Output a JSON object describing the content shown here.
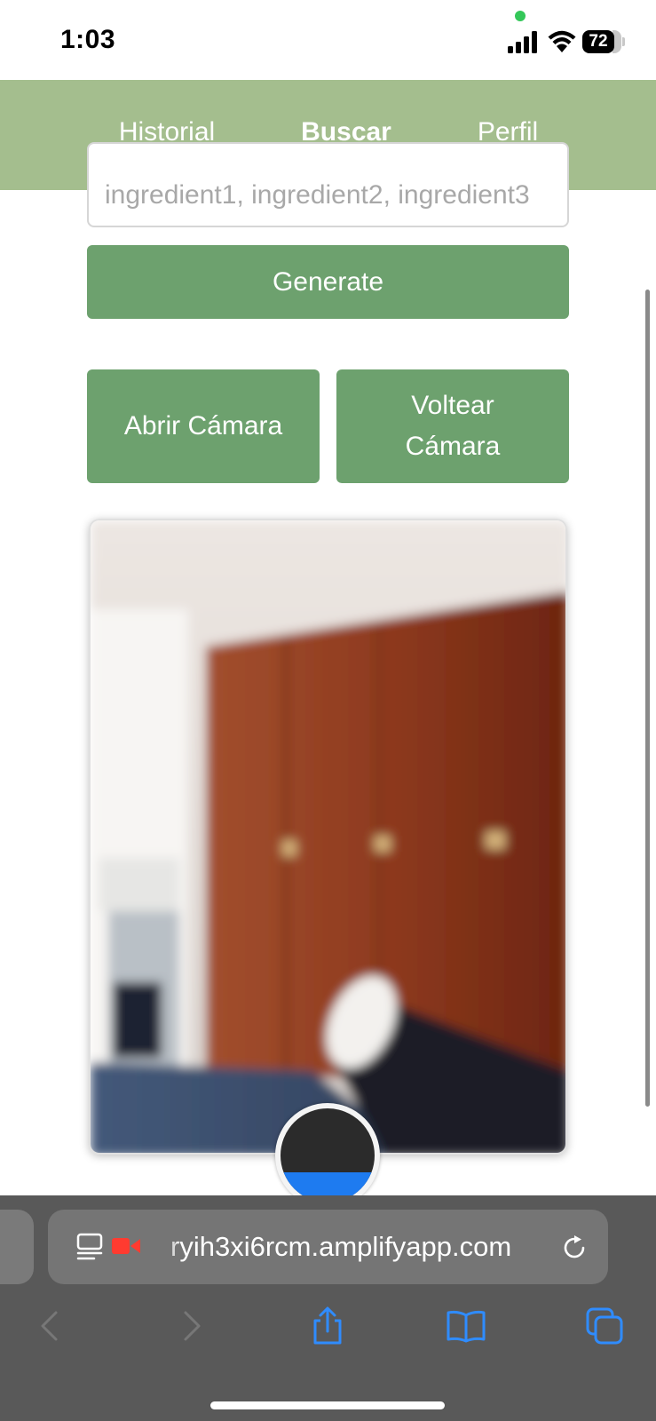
{
  "status_bar": {
    "time": "1:03",
    "battery": "72",
    "icons": [
      "camera-in-use-dot",
      "signal-icon",
      "wifi-icon",
      "battery-icon"
    ]
  },
  "nav": {
    "tabs": [
      {
        "label": "Historial",
        "active": false
      },
      {
        "label": "Buscar",
        "active": true
      },
      {
        "label": "Perfil",
        "active": false
      }
    ],
    "background_color": "#a4be8e"
  },
  "search": {
    "placeholder": "ingredient1, ingredient2, ingredient3",
    "value": ""
  },
  "buttons": {
    "generate": "Generate",
    "open_camera": "Abrir Cámara",
    "flip_camera": "Voltear Cámara",
    "color": "#6da16e"
  },
  "camera": {
    "icon": "live-camera-preview",
    "capture_icon": "capture-button",
    "capture_accent": "#1e7bf0"
  },
  "browser": {
    "url": "ryih3xi6rcm.amplifyapp.com",
    "icons": [
      "reader-icon",
      "video-recording-icon",
      "reload-icon",
      "back-icon",
      "forward-icon",
      "share-icon",
      "bookmarks-icon",
      "tabs-icon"
    ]
  }
}
